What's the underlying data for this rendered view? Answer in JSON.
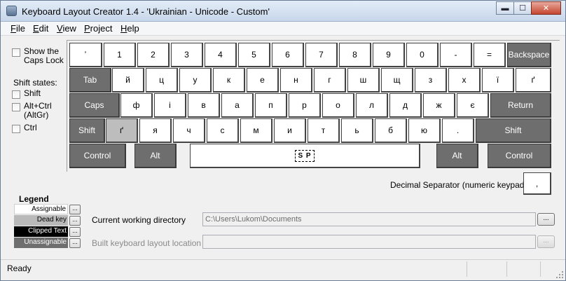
{
  "window": {
    "title": "Keyboard Layout Creator 1.4 - 'Ukrainian - Unicode - Custom'"
  },
  "menu": [
    {
      "first": "F",
      "rest": "ile"
    },
    {
      "first": "E",
      "rest": "dit"
    },
    {
      "first": "V",
      "rest": "iew"
    },
    {
      "first": "P",
      "rest": "roject"
    },
    {
      "first": "H",
      "rest": "elp"
    }
  ],
  "options": {
    "show_caps_lock": "Show the Caps Lock",
    "shift_states_title": "Shift states:",
    "shift": "Shift",
    "altgr": "Alt+Ctrl (AltGr)",
    "ctrl": "Ctrl"
  },
  "keys": {
    "row1": [
      "ʼ",
      "1",
      "2",
      "3",
      "4",
      "5",
      "6",
      "7",
      "8",
      "9",
      "0",
      "-",
      "=",
      "Backspace"
    ],
    "row2": [
      "Tab",
      "й",
      "ц",
      "у",
      "к",
      "е",
      "н",
      "г",
      "ш",
      "щ",
      "з",
      "х",
      "ї",
      "ґ"
    ],
    "row3": [
      "Caps",
      "ф",
      "і",
      "в",
      "а",
      "п",
      "р",
      "о",
      "л",
      "д",
      "ж",
      "є",
      "Return"
    ],
    "row4": [
      "Shift",
      "ґ",
      "я",
      "ч",
      "с",
      "м",
      "и",
      "т",
      "ь",
      "б",
      "ю",
      ".",
      "Shift"
    ],
    "row5": [
      "Control",
      "Alt",
      "S P",
      "Alt",
      "Control"
    ]
  },
  "decimal": {
    "label": "Decimal Separator (numeric keypad)",
    "value": ","
  },
  "legend": {
    "title": "Legend",
    "items": [
      "Assignable",
      "Dead key",
      "Clipped Text",
      "Unassignable"
    ],
    "button": "..."
  },
  "fields": {
    "cwd_label": "Current working directory",
    "cwd_value": "C:\\Users\\Lukom\\Documents",
    "built_label": "Built keyboard layout location",
    "built_value": "",
    "browse": "..."
  },
  "status": {
    "text": "Ready"
  },
  "window_buttons": {
    "minimize": "▬",
    "maximize": "☐",
    "close": "✕"
  }
}
